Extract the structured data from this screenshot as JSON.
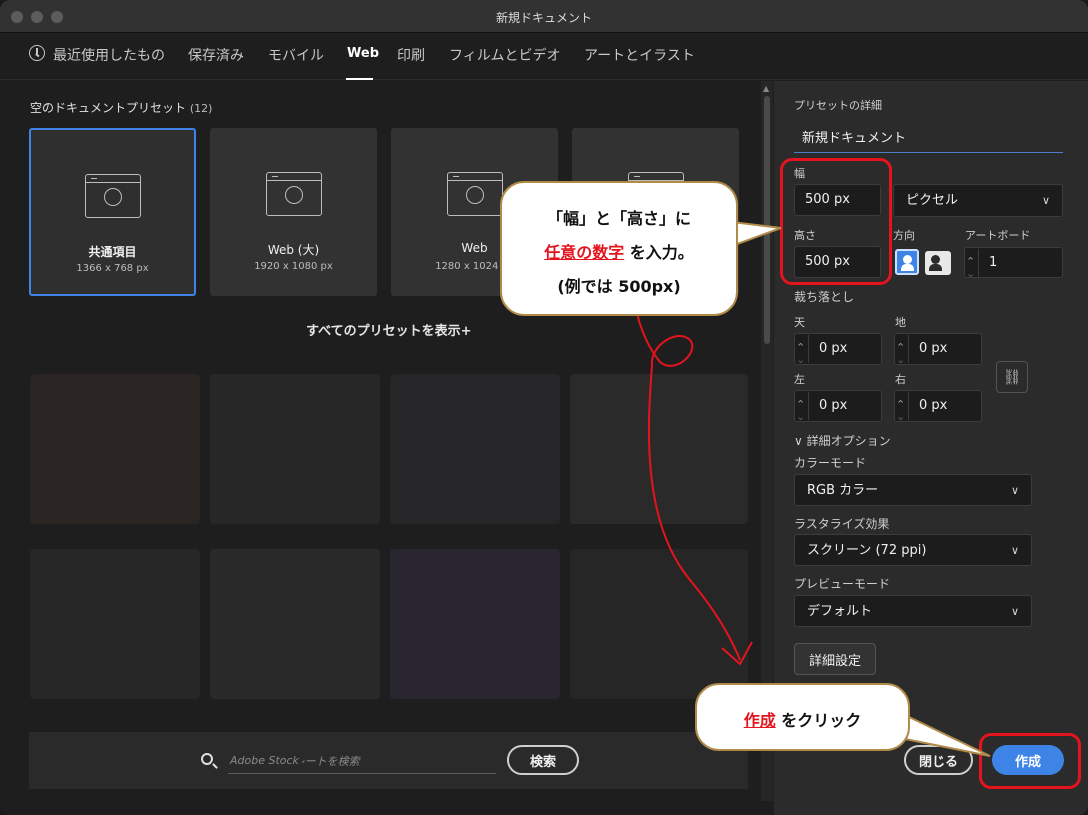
{
  "window": {
    "title": "新規ドキュメント"
  },
  "tabs": [
    {
      "label": "最近使用したもの"
    },
    {
      "label": "保存済み"
    },
    {
      "label": "モバイル"
    },
    {
      "label": "Web"
    },
    {
      "label": "印刷"
    },
    {
      "label": "フィルムとビデオ"
    },
    {
      "label": "アートとイラスト"
    }
  ],
  "presets": {
    "section_title": "空のドキュメントプリセット",
    "count": "(12)",
    "cards": [
      {
        "name": "共通項目",
        "size": "1366 x 768 px"
      },
      {
        "name": "Web (大)",
        "size": "1920 x 1080 px"
      },
      {
        "name": "Web",
        "size": "1280 x 1024 px"
      }
    ],
    "show_all": "すべてのプリセットを表示+"
  },
  "search": {
    "placeholder_brand": "Adobe Stock",
    "placeholder": "で他のテンプレートを検索",
    "button": "検索"
  },
  "details": {
    "section_title": "プリセットの詳細",
    "doc_name": "新規ドキュメント",
    "width_label": "幅",
    "width_value": "500 px",
    "unit": "ピクセル",
    "height_label": "高さ",
    "height_value": "500 px",
    "orientation_label": "方向",
    "artboard_label": "アートボード",
    "artboard_value": "1",
    "bleed_label": "裁ち落とし",
    "top_label": "天",
    "top_value": "0 px",
    "bottom_label": "地",
    "bottom_value": "0 px",
    "left_label": "左",
    "left_value": "0 px",
    "right_label": "右",
    "right_value": "0 px",
    "advanced_toggle": "詳細オプション",
    "color_mode_label": "カラーモード",
    "color_mode": "RGB カラー",
    "raster_label": "ラスタライズ効果",
    "raster": "スクリーン (72 ppi)",
    "preview_label": "プレビューモード",
    "preview": "デフォルト",
    "advanced_button": "詳細設定",
    "close_button": "閉じる",
    "create_button": "作成"
  },
  "annotations": {
    "bubble1_line1": "「幅」と「高さ」に",
    "bubble1_red": "任意の数字",
    "bubble1_line2b": "を入力。",
    "bubble1_line3": "(例では 500px)",
    "bubble2_red": "作成",
    "bubble2_rest": "をクリック",
    "highlight_color": "#e3141e",
    "accent": "#3d84e6"
  }
}
